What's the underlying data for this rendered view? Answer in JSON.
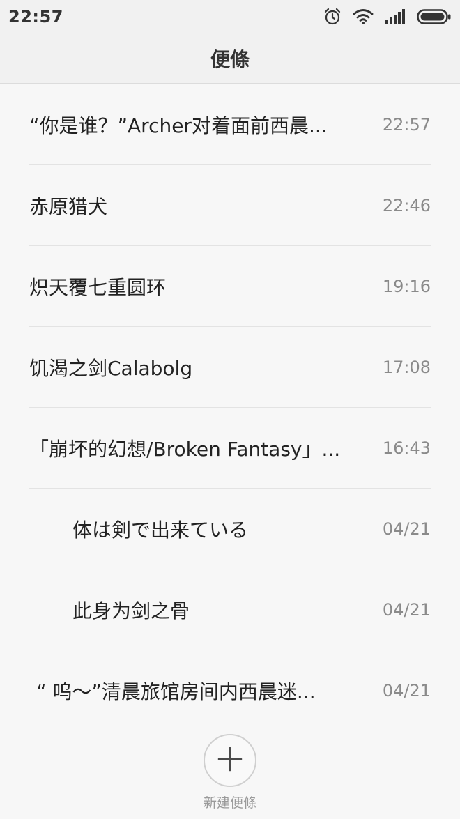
{
  "status_bar": {
    "time": "22:57",
    "icons": [
      "alarm-icon",
      "wifi-icon",
      "signal-icon",
      "battery-icon"
    ]
  },
  "header": {
    "title": "便條"
  },
  "notes": [
    {
      "title": "“你是谁？”Archer对着面前西晨...",
      "time": "22:57"
    },
    {
      "title": "赤原猎犬",
      "time": "22:46"
    },
    {
      "title": "炽天覆七重圆环",
      "time": "19:16"
    },
    {
      "title": "饥渴之剑Calabolg",
      "time": "17:08"
    },
    {
      "title": "「崩坏的幻想/Broken Fantasy」...",
      "time": "16:43"
    },
    {
      "title": "体は剣で出来ている",
      "time": "04/21"
    },
    {
      "title": "此身为剑之骨",
      "time": "04/21"
    },
    {
      "title": "“ 呜～”清晨旅馆房间内西晨迷...",
      "time": "04/21"
    }
  ],
  "footer": {
    "new_note_label": "新建便條"
  },
  "colors": {
    "background": "#f7f7f7",
    "divider": "#e3e3e3",
    "text": "#222222",
    "time": "#8a8a8a"
  }
}
